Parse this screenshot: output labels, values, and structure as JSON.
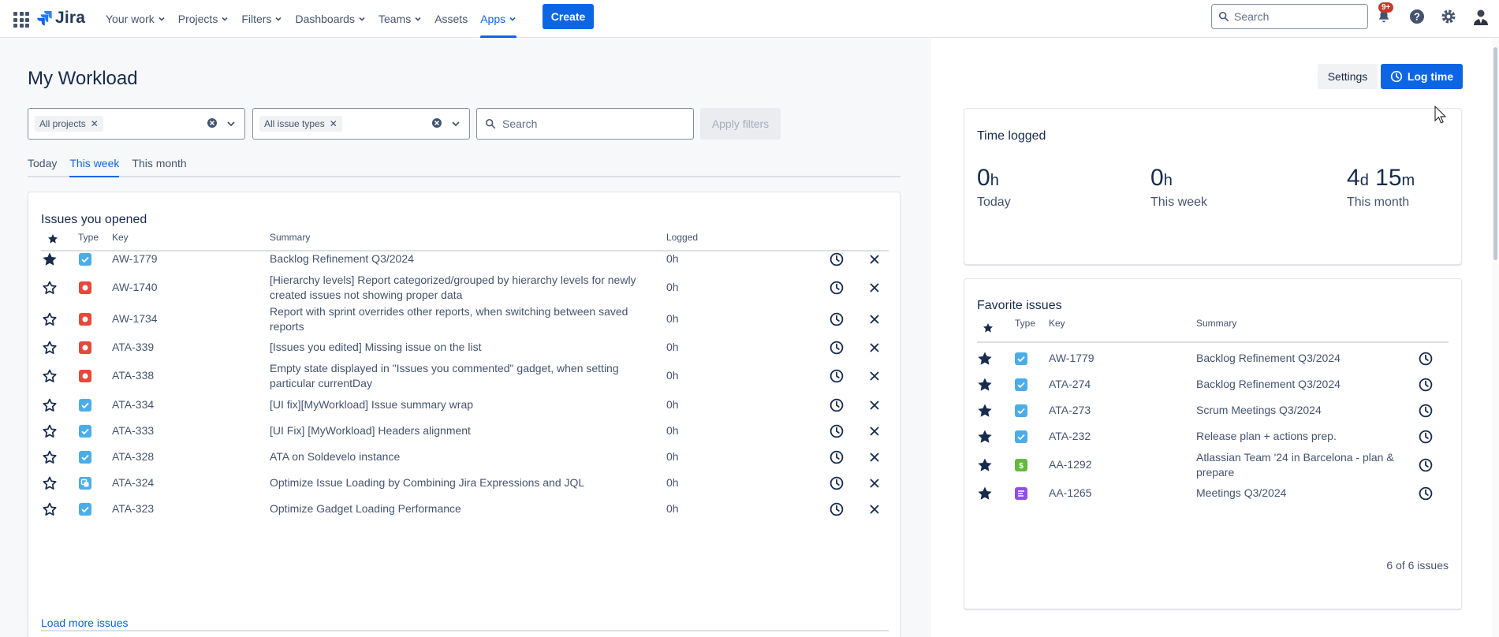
{
  "nav": {
    "app_name": "Jira",
    "items": [
      {
        "label": "Your work",
        "dropdown": true
      },
      {
        "label": "Projects",
        "dropdown": true
      },
      {
        "label": "Filters",
        "dropdown": true
      },
      {
        "label": "Dashboards",
        "dropdown": true
      },
      {
        "label": "Teams",
        "dropdown": true
      },
      {
        "label": "Assets",
        "dropdown": false
      },
      {
        "label": "Apps",
        "dropdown": true,
        "active": true
      }
    ],
    "create_label": "Create",
    "search_placeholder": "Search",
    "notification_badge": "9+"
  },
  "page": {
    "title": "My Workload",
    "filters": {
      "projects_chip": "All projects",
      "issue_types_chip": "All issue types",
      "search_placeholder": "Search",
      "apply_label": "Apply filters"
    },
    "tabs": [
      {
        "label": "Today",
        "active": false
      },
      {
        "label": "This week",
        "active": true
      },
      {
        "label": "This month",
        "active": false
      }
    ]
  },
  "issues_opened": {
    "title": "Issues you opened",
    "headers": {
      "type": "Type",
      "key": "Key",
      "summary": "Summary",
      "logged": "Logged"
    },
    "rows": [
      {
        "starred": true,
        "type": "task",
        "key": "AW-1779",
        "summary_l1": "Backlog Refinement Q3/2024",
        "summary_l2": "",
        "logged": "0h"
      },
      {
        "starred": false,
        "type": "bug",
        "key": "AW-1740",
        "summary_l1": "[Hierarchy levels] Report categorized/grouped by hierarchy levels for newly",
        "summary_l2": "created issues not showing proper data",
        "logged": "0h"
      },
      {
        "starred": false,
        "type": "bug",
        "key": "AW-1734",
        "summary_l1": "Report with sprint overrides other reports, when switching between saved",
        "summary_l2": "reports",
        "logged": "0h"
      },
      {
        "starred": false,
        "type": "bug",
        "key": "ATA-339",
        "summary_l1": "[Issues you edited] Missing issue on the list",
        "summary_l2": "",
        "logged": "0h"
      },
      {
        "starred": false,
        "type": "bug",
        "key": "ATA-338",
        "summary_l1": "Empty state displayed in \"Issues you commented\" gadget, when setting",
        "summary_l2": "particular currentDay",
        "logged": "0h"
      },
      {
        "starred": false,
        "type": "task",
        "key": "ATA-334",
        "summary_l1": "[UI fix][MyWorkload] Issue summary wrap",
        "summary_l2": "",
        "logged": "0h"
      },
      {
        "starred": false,
        "type": "task",
        "key": "ATA-333",
        "summary_l1": "[UI Fix] [MyWorkload] Headers alignment",
        "summary_l2": "",
        "logged": "0h"
      },
      {
        "starred": false,
        "type": "task",
        "key": "ATA-328",
        "summary_l1": "ATA on Soldevelo instance",
        "summary_l2": "",
        "logged": "0h"
      },
      {
        "starred": false,
        "type": "subtask",
        "key": "ATA-324",
        "summary_l1": "Optimize Issue Loading by Combining Jira Expressions and JQL",
        "summary_l2": "",
        "logged": "0h"
      },
      {
        "starred": false,
        "type": "task",
        "key": "ATA-323",
        "summary_l1": "Optimize Gadget Loading Performance",
        "summary_l2": "",
        "logged": "0h"
      }
    ],
    "load_more": "Load more issues"
  },
  "right": {
    "settings_label": "Settings",
    "log_time_label": "Log time",
    "time_logged": {
      "title": "Time logged",
      "today": {
        "value": "0",
        "unit": "h",
        "label": "Today"
      },
      "week": {
        "value": "0",
        "unit": "h",
        "label": "This week"
      },
      "month": {
        "value1": "4",
        "unit1": "d",
        "value2": "15",
        "unit2": "m",
        "label": "This month"
      }
    },
    "favorites": {
      "title": "Favorite issues",
      "headers": {
        "type": "Type",
        "key": "Key",
        "summary": "Summary"
      },
      "rows": [
        {
          "type": "task",
          "key": "AW-1779",
          "summary_l1": "Backlog Refinement Q3/2024",
          "summary_l2": ""
        },
        {
          "type": "task",
          "key": "ATA-274",
          "summary_l1": "Backlog Refinement Q3/2024",
          "summary_l2": ""
        },
        {
          "type": "task",
          "key": "ATA-273",
          "summary_l1": "Scrum Meetings Q3/2024",
          "summary_l2": ""
        },
        {
          "type": "task",
          "key": "ATA-232",
          "summary_l1": "Release plan + actions prep.",
          "summary_l2": ""
        },
        {
          "type": "story",
          "key": "AA-1292",
          "summary_l1": "Atlassian Team '24 in Barcelona - plan &",
          "summary_l2": "prepare"
        },
        {
          "type": "epic",
          "key": "AA-1265",
          "summary_l1": "Meetings Q3/2024",
          "summary_l2": ""
        }
      ],
      "count": "6 of 6 issues"
    }
  },
  "colors": {
    "accent": "#0c66e4",
    "task": "#4bade8",
    "bug": "#e5493a",
    "story": "#63ba3c",
    "epic": "#904ee2"
  }
}
